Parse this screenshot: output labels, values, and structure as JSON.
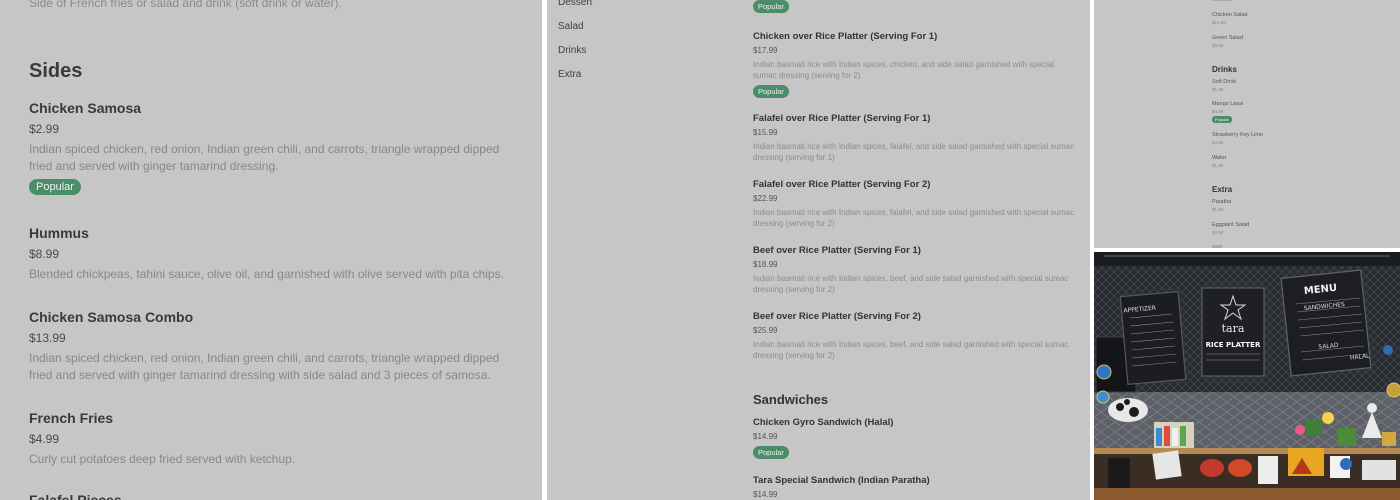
{
  "left": {
    "top_text": "Side of French fries or salad and drink (soft drink or water).",
    "section_title": "Sides",
    "items": [
      {
        "name": "Chicken Samosa",
        "price": "$2.99",
        "description": "Indian spiced chicken, red onion, Indian green chili, and carrots, triangle wrapped dipped fried and served with ginger tamarind dressing.",
        "badge": "Popular"
      },
      {
        "name": "Hummus",
        "price": "$8.99",
        "description": "Blended chickpeas, tahini sauce, olive oil, and garnished with olive served with pita chips."
      },
      {
        "name": "Chicken Samosa Combo",
        "price": "$13.99",
        "description": "Indian spiced chicken, red onion, Indian green chili, and carrots, triangle wrapped dipped fried and served with ginger tamarind dressing with side salad and 3 pieces of samosa."
      },
      {
        "name": "French Fries",
        "price": "$4.99",
        "description": "Curly cut potatoes deep fried served with ketchup."
      },
      {
        "name": "Falafel Pieces"
      }
    ]
  },
  "middle": {
    "categories": [
      "Dessert",
      "Salad",
      "Drinks",
      "Extra"
    ],
    "top_badge": "Popular",
    "items": [
      {
        "name": "Chicken over Rice Platter (Serving For 1)",
        "price": "$17.99",
        "description": "Indian basmati rice with Indian spices, chicken, and side salad garnished with special sumac dressing (serving for 2)",
        "badge": "Popular"
      },
      {
        "name": "Falafel over Rice Platter (Serving For 1)",
        "price": "$15.99",
        "description": "Indian basmati rice with Indian spices, falafel, and side salad garnished with special sumac dressing (serving for 1)"
      },
      {
        "name": "Falafel over Rice Platter (Serving For 2)",
        "price": "$22.99",
        "description": "Indian basmati rice with Indian spices, falafel, and side salad garnished with special sumac dressing (serving for 2)"
      },
      {
        "name": "Beef over Rice Platter (Serving For 1)",
        "price": "$18.99",
        "description": "Indian basmati rice with Indian spices, beef, and side salad garnished with special sumac dressing (serving for 2)"
      },
      {
        "name": "Beef over Rice Platter (Serving For 2)",
        "price": "$25.99",
        "description": "Indian basmati rice with Indian spices, beef, and side salad garnished with special sumac dressing (serving for 2)"
      }
    ],
    "section_title": "Sandwiches",
    "sandwiches": [
      {
        "name": "Chicken Gyro Sandwich (Halal)",
        "price": "$14.99",
        "badge": "Popular"
      },
      {
        "name": "Tara Special Sandwich (Indian Paratha)",
        "price": "$14.99"
      }
    ]
  },
  "right_top": {
    "salad_items": [
      {
        "name": "Chicken Salad",
        "price": "$16.99"
      },
      {
        "name": "Green Salad",
        "price": "$3.99"
      }
    ],
    "drinks_title": "Drinks",
    "drink_items": [
      {
        "name": "Soft Drink",
        "price": "$1.99"
      },
      {
        "name": "Mango Lassi",
        "price": "$4.99",
        "badge": "Popular"
      },
      {
        "name": "Strawberry Key Lime",
        "price": "$4.99"
      },
      {
        "name": "Water",
        "price": "$1.99"
      }
    ],
    "extra_title": "Extra",
    "extra_items": [
      {
        "name": "Paratha",
        "price": "$1.50"
      },
      {
        "name": "Eggplant Salad",
        "price": "$4.99"
      }
    ]
  },
  "photo": {
    "sign_appetizer": "APPETIZER",
    "sign_brand": "tara",
    "sign_platter": "RICE PLATTER",
    "sign_menu": "MENU",
    "sign_sandwiches": "SANDWICHES",
    "sign_salad": "SALAD",
    "sign_halal": "HALAL"
  },
  "colors": {
    "panel_bg": "#c6c6c6",
    "badge_bg": "#4a8d69",
    "photo_bg": "#2b2b2e"
  }
}
